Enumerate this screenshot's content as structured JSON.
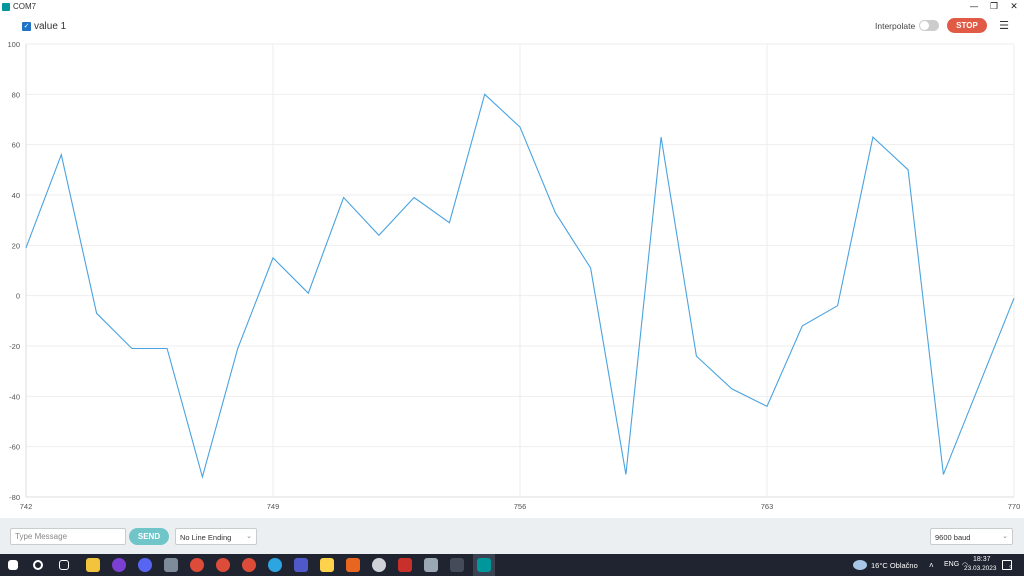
{
  "window": {
    "title": "COM7",
    "controls": [
      "—",
      "❐",
      "✕"
    ]
  },
  "toolbar": {
    "legend_label": "value 1",
    "interpolate_label": "Interpolate",
    "stop_label": "STOP",
    "menu_glyph": "☰"
  },
  "colors": {
    "line": "#4aa3df",
    "stop": "#e05a45",
    "send": "#6fc5c7",
    "taskbar": "#1f2430"
  },
  "chart_data": {
    "type": "line",
    "series": [
      {
        "name": "value 1",
        "x": [
          742,
          743,
          744,
          745,
          746,
          747,
          748,
          749,
          750,
          751,
          752,
          753,
          754,
          755,
          756,
          757,
          758,
          759,
          760,
          761,
          762,
          763,
          764,
          765,
          766,
          767,
          768,
          769,
          770
        ],
        "values": [
          19,
          56,
          -7,
          -21,
          -21,
          -72,
          -21,
          15,
          1,
          39,
          24,
          39,
          29,
          80,
          67,
          33,
          11,
          -71,
          63,
          -24,
          -37,
          -44,
          -12,
          -4,
          63,
          50,
          -71,
          -36,
          -1
        ]
      }
    ],
    "xlim": [
      742,
      770
    ],
    "ylim": [
      -80,
      100
    ],
    "x_ticks": [
      "742",
      "749",
      "756",
      "763",
      "770"
    ],
    "y_ticks": [
      "100",
      "80",
      "60",
      "40",
      "20",
      "0",
      "-20",
      "-40",
      "-60",
      "-80"
    ],
    "grid": true
  },
  "bottom": {
    "message_placeholder": "Type Message",
    "send_label": "SEND",
    "line_ending": "No Line Ending",
    "baud": "9600 baud",
    "chevron": "⌄"
  },
  "taskbar": {
    "weather": "16°C  Oblačno",
    "lang": "ENG",
    "time": "18:37",
    "date": "23.03.2023",
    "notif_count": "3"
  }
}
